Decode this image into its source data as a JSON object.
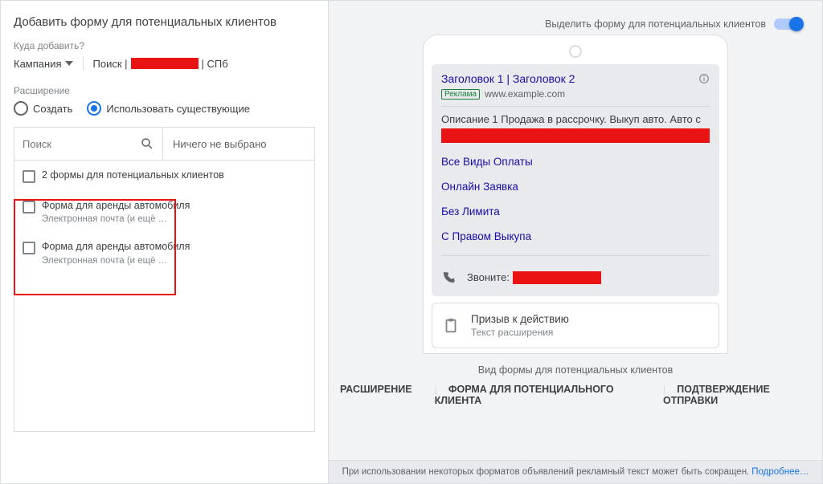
{
  "left": {
    "title": "Добавить форму для потенциальных клиентов",
    "where_label": "Куда добавить?",
    "campaign": "Кампания",
    "search_prefix": "Поиск |",
    "search_suffix": "| СПб",
    "ext_label": "Расширение",
    "radio_create": "Создать",
    "radio_use": "Использовать существующие",
    "search_ph": "Поиск",
    "none_selected": "Ничего не выбрано",
    "items": [
      {
        "title": "2 формы для потенциальных клиентов",
        "sub": ""
      },
      {
        "title": "Форма для аренды автомобиля",
        "sub": "Электронная почта (и ещё …"
      },
      {
        "title": "Форма для аренды автомобиля",
        "sub": "Электронная почта (и ещё …"
      }
    ]
  },
  "right": {
    "toggle_label": "Выделить форму для потенциальных клиентов",
    "toggle_on": true,
    "ad": {
      "headline": "Заголовок 1 | Заголовок 2",
      "badge": "Реклама",
      "url": "www.example.com",
      "desc": "Описание 1 Продажа в рассрочку. Выкуп авто. Авто с",
      "sitelinks": [
        "Все Виды Оплаты",
        "Онлайн Заявка",
        "Без Лимита",
        "С Правом Выкупа"
      ],
      "call_label": "Звоните:",
      "cta_title": "Призыв к действию",
      "cta_sub": "Текст расширения"
    },
    "caption": "Вид формы для потенциальных клиентов",
    "tabs": [
      "РАСШИРЕНИЕ",
      "ФОРМА ДЛЯ ПОТЕНЦИАЛЬНОГО КЛИЕНТА",
      "ПОДТВЕРЖДЕНИЕ ОТПРАВКИ"
    ],
    "footer_text": "При использовании некоторых форматов объявлений рекламный текст может быть сокращен.",
    "footer_link": "Подробнее…"
  }
}
